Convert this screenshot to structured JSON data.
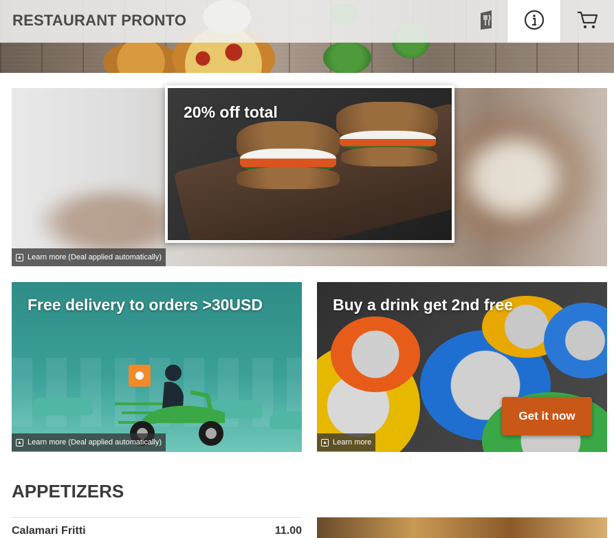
{
  "header": {
    "title": "RESTAURANT PRONTO",
    "icons": [
      "menu-book-icon",
      "info-icon",
      "cart-icon"
    ]
  },
  "carousel": {
    "promo_title": "20% off total",
    "learn_more": "Learn more (Deal applied automatically)"
  },
  "cards": [
    {
      "title": "Free delivery to orders >30USD",
      "learn_more": "Learn more (Deal applied automatically)"
    },
    {
      "title": "Buy a drink get 2nd free",
      "learn_more": "Learn more",
      "cta": "Get it now"
    }
  ],
  "menu": {
    "section": "APPETIZERS",
    "items": [
      {
        "name": "Calamari Fritti",
        "price": "11.00"
      }
    ]
  },
  "colors": {
    "cta": "#c95718",
    "brand_text": "#4a4a4a"
  }
}
